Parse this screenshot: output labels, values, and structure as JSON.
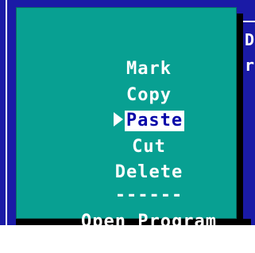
{
  "background": {
    "partial_text_1": "D",
    "partial_text_2": "r"
  },
  "menu": {
    "items": [
      {
        "label": "Mark"
      },
      {
        "label": "Copy"
      },
      {
        "label": "Paste",
        "selected": true
      },
      {
        "label": "Cut"
      },
      {
        "label": "Delete"
      },
      {
        "label": "------"
      },
      {
        "label": "Open Program"
      }
    ],
    "pointer_icon": "triangle-pointer-icon"
  },
  "colors": {
    "menu_bg": "#08a092",
    "window_bg": "#1a1aa6",
    "selected_bg": "#ffffff",
    "selected_text": "#0707a8",
    "text": "#ffffff"
  }
}
